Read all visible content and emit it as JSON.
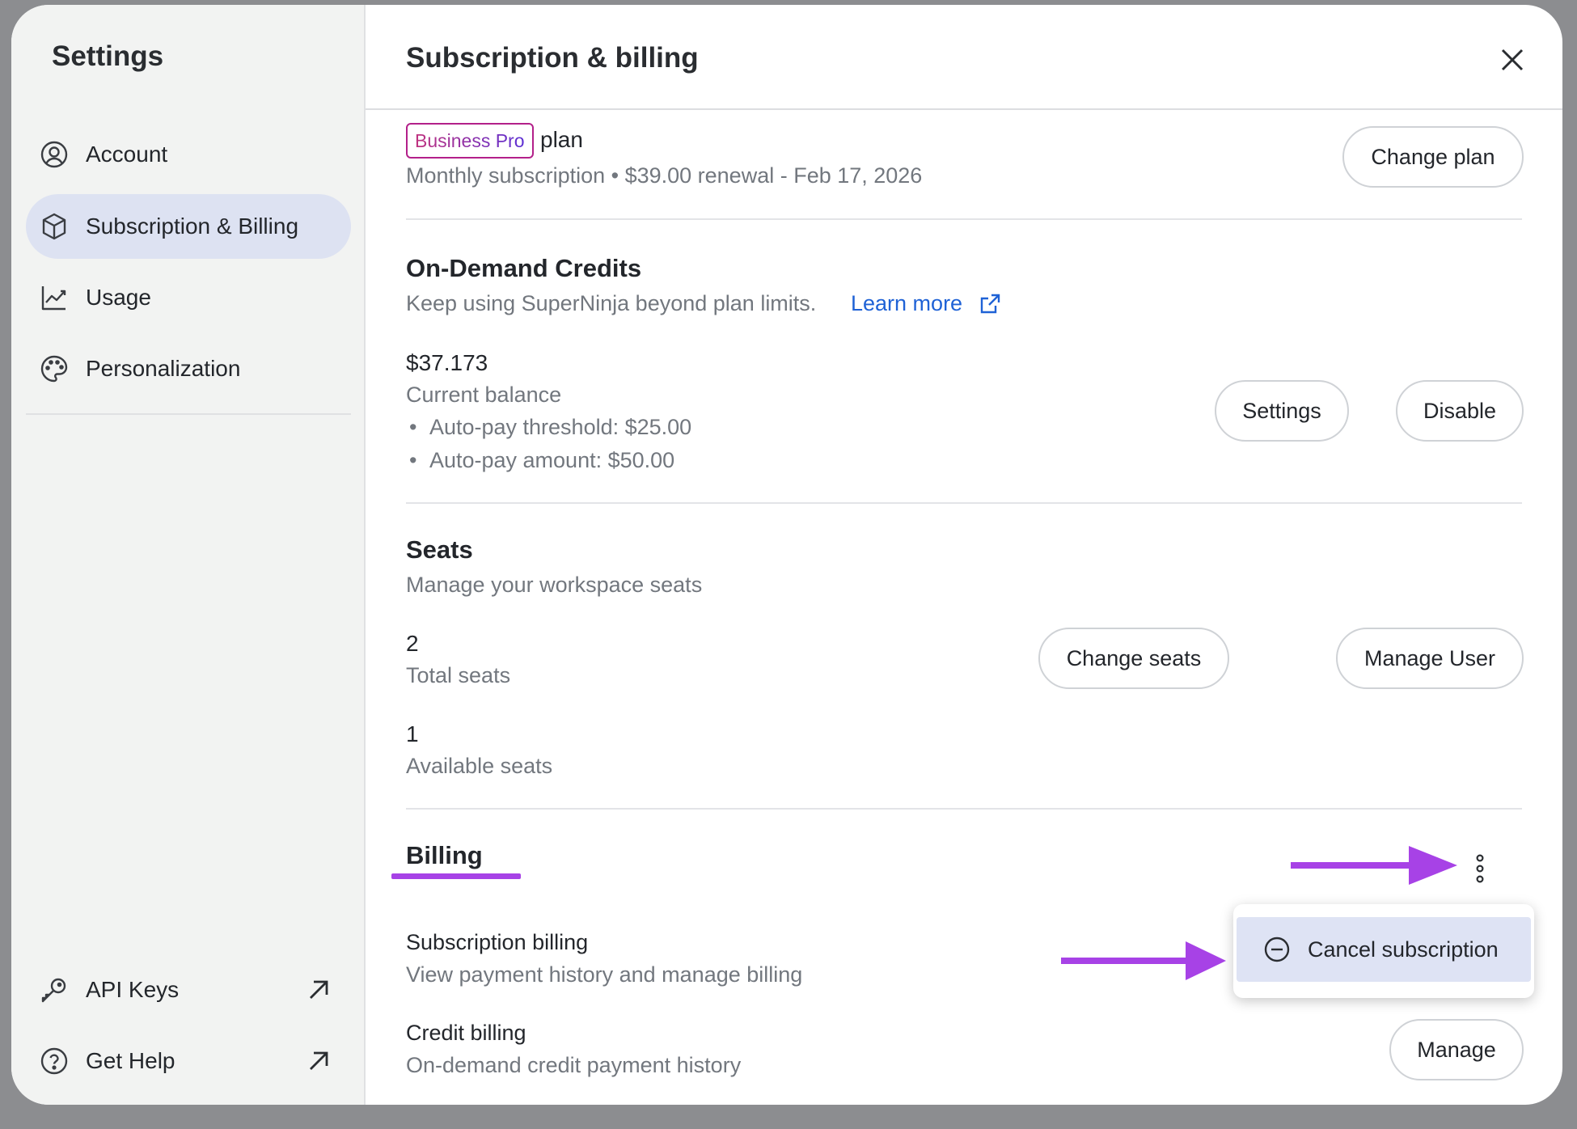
{
  "sidebar": {
    "title": "Settings",
    "items": [
      {
        "label": "Account",
        "icon": "user-circle-icon"
      },
      {
        "label": "Subscription & Billing",
        "icon": "package-icon",
        "active": true
      },
      {
        "label": "Usage",
        "icon": "chart-line-icon"
      },
      {
        "label": "Personalization",
        "icon": "palette-icon"
      }
    ],
    "bottom_items": [
      {
        "label": "API Keys",
        "icon": "key-icon",
        "trailing_icon": "arrow-up-right-icon"
      },
      {
        "label": "Get Help",
        "icon": "help-circle-icon",
        "trailing_icon": "arrow-up-right-icon"
      }
    ]
  },
  "header": {
    "title": "Subscription & billing",
    "close_icon": "close-icon"
  },
  "plan": {
    "badge": "Business Pro",
    "suffix": "plan",
    "details": "Monthly subscription • $39.00 renewal - Feb 17, 2026",
    "change_button": "Change plan"
  },
  "credits": {
    "title": "On-Demand Credits",
    "description": "Keep using SuperNinja beyond plan limits.",
    "learn_more": "Learn more",
    "balance": "$37.173",
    "balance_label": "Current balance",
    "bullets": [
      "Auto-pay threshold: $25.00",
      "Auto-pay amount: $50.00"
    ],
    "settings_button": "Settings",
    "disable_button": "Disable"
  },
  "seats": {
    "title": "Seats",
    "description": "Manage your workspace seats",
    "total": "2",
    "total_label": "Total seats",
    "available": "1",
    "available_label": "Available seats",
    "change_button": "Change seats",
    "manage_button": "Manage User"
  },
  "billing": {
    "title": "Billing",
    "more_icon": "more-vertical-icon",
    "subscription_title": "Subscription billing",
    "subscription_desc": "View payment history and manage billing",
    "credit_title": "Credit billing",
    "credit_desc": "On-demand credit payment history",
    "manage_button": "Manage",
    "menu": {
      "cancel_label": "Cancel subscription",
      "cancel_icon": "minus-circle-icon"
    }
  },
  "colors": {
    "annotation": "#a742e6",
    "link": "#1f62d6",
    "active_nav": "#dde2f2",
    "menu_highlight": "#dee3f4"
  }
}
